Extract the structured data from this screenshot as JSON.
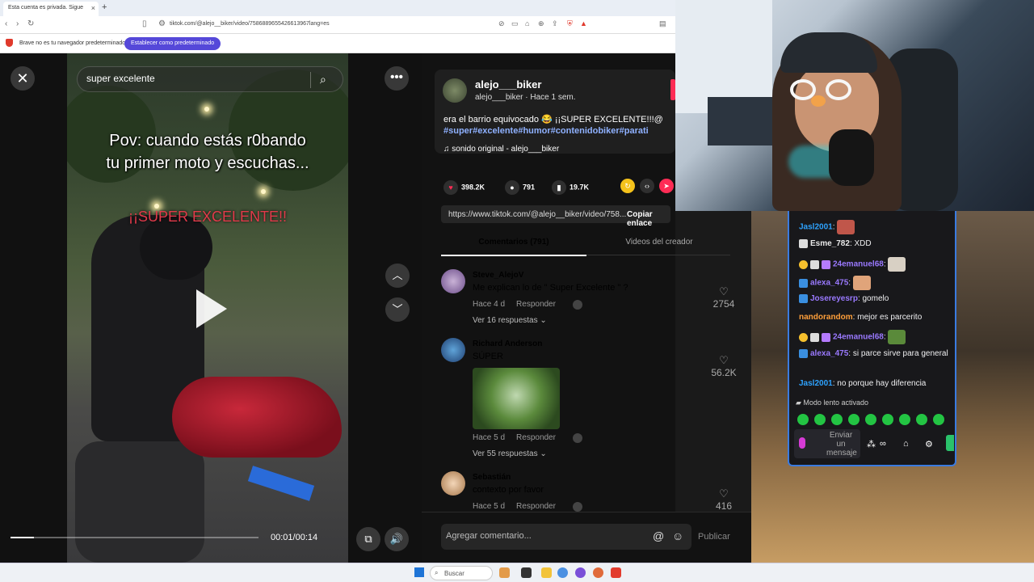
{
  "browser": {
    "tab_title": "Esta cuenta es privada. Sigue",
    "tab_close": "×",
    "new_tab": "+",
    "url": "tiktok.com/@alejo__biker/video/7586889655426613967lang=es",
    "infobar_text": "Brave no es tu navegador predeterminado",
    "infobar_button": "Establecer como predeterminado"
  },
  "video": {
    "search_value": "super excelente",
    "overlay_line1": "Pov: cuando estás r0bando",
    "overlay_line2": "tu primer moto y escuchas...",
    "overlay_caption": "¡¡SUPER EXCELENTE!!",
    "progress_fraction": 0.095,
    "time": "00:01/00:14",
    "close_glyph": "✕",
    "more_glyph": "•••",
    "up_glyph": "︿",
    "down_glyph": "﹀"
  },
  "post": {
    "username": "alejo___biker",
    "meta": "alejo___biker · Hace 1 sem.",
    "description": "era el barrio equivocado 😂 ¡¡SUPER EXCELENTE!!!@",
    "hashtags": "#super#excelente#humor#contenidobiker#parati",
    "music": "sonido original - alejo___biker",
    "likes": "398.2K",
    "comments": "791",
    "saves": "19.7K",
    "link": "https://www.tiktok.com/@alejo__biker/video/758...",
    "copy_label": "Copiar enlace"
  },
  "tabs": {
    "comments": "Comentarios (791)",
    "creator_videos": "Videos del creador"
  },
  "comments": [
    {
      "name": "Steve_AlejoV",
      "text": "Me explican lo de \" Super Excelente \" ?",
      "when": "Hace 4 d",
      "reply": "Responder",
      "replies": "Ver 16 respuestas",
      "likes": "2754"
    },
    {
      "name": "Richard Anderson",
      "text": "SÚPER",
      "when": "Hace 5 d",
      "reply": "Responder",
      "replies": "Ver 55 respuestas",
      "likes": "56.2K"
    },
    {
      "name": "Sebastián",
      "text": "contexto por favor",
      "when": "Hace 5 d",
      "reply": "Responder",
      "likes": "416"
    }
  ],
  "composer": {
    "placeholder": "Agregar comentario...",
    "publish": "Publicar"
  },
  "chat": {
    "messages": [
      {
        "user": "Jasl2001",
        "text": ""
      },
      {
        "user": "Esme_782",
        "text": "XDD"
      },
      {
        "user": "24emanuel68",
        "text": ""
      },
      {
        "user": "alexa_475",
        "text": ""
      },
      {
        "user": "Josereyesrp",
        "text": "gomelo"
      },
      {
        "user": "nandorandom",
        "text": "mejor es parcerito"
      },
      {
        "user": "24emanuel68",
        "text": ""
      },
      {
        "user": "alexa_475",
        "text": "si parce sirve para general"
      },
      {
        "user": "Jasl2001",
        "text": "no porque hay diferencia"
      }
    ],
    "slow_mode": "Modo lento activado",
    "input_placeholder": "Enviar un mensaje"
  },
  "taskbar": {
    "search": "Buscar"
  }
}
